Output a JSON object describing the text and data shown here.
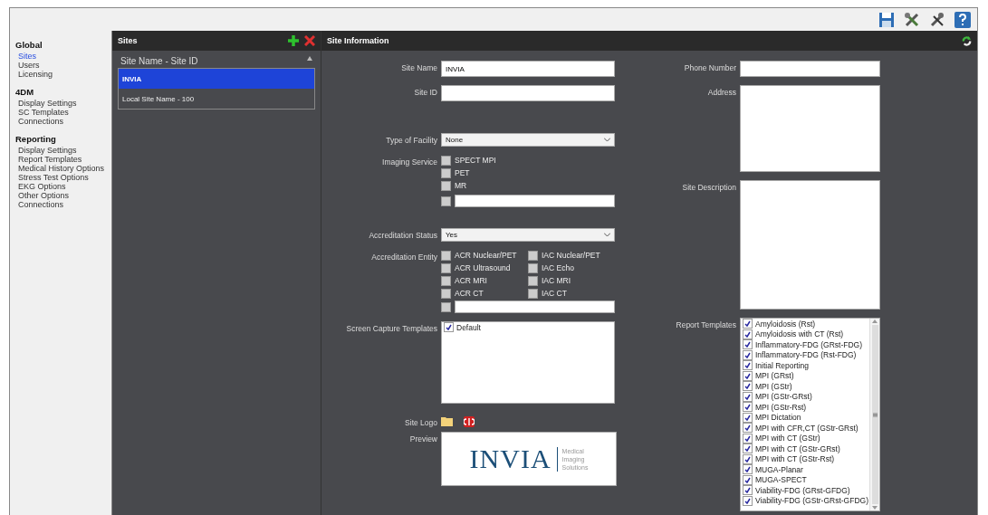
{
  "sidebar": {
    "sections": [
      {
        "title": "Global",
        "items": [
          {
            "label": "Sites",
            "selected": true
          },
          {
            "label": "Users",
            "selected": false
          },
          {
            "label": "Licensing",
            "selected": false
          }
        ]
      },
      {
        "title": "4DM",
        "items": [
          {
            "label": "Display Settings",
            "selected": false
          },
          {
            "label": "SC Templates",
            "selected": false
          },
          {
            "label": "Connections",
            "selected": false
          }
        ]
      },
      {
        "title": "Reporting",
        "items": [
          {
            "label": "Display Settings",
            "selected": false
          },
          {
            "label": "Report Templates",
            "selected": false
          },
          {
            "label": "Medical History Options",
            "selected": false
          },
          {
            "label": "Stress Test Options",
            "selected": false
          },
          {
            "label": "EKG Options",
            "selected": false
          },
          {
            "label": "Other Options",
            "selected": false
          },
          {
            "label": "Connections",
            "selected": false
          }
        ]
      }
    ]
  },
  "sites": {
    "title": "Sites",
    "column": "Site Name - Site ID",
    "rows": [
      {
        "label": "INVIA",
        "selected": true
      },
      {
        "label": "Local Site Name - 100",
        "selected": false
      }
    ]
  },
  "site_information": {
    "title": "Site Information",
    "site_name": {
      "label": "Site Name",
      "value": "INVIA"
    },
    "site_id": {
      "label": "Site ID"
    },
    "type_of_facility": {
      "label": "Type of Facility",
      "value": "None"
    },
    "imaging_service": {
      "label": "Imaging Service",
      "options": [
        {
          "label": "SPECT MPI",
          "checked": false
        },
        {
          "label": "PET",
          "checked": false
        },
        {
          "label": "MR",
          "checked": false
        }
      ],
      "other_checked": false
    },
    "accreditation_status": {
      "label": "Accreditation Status",
      "value": "Yes"
    },
    "accreditation_entity": {
      "label": "Accreditation Entity",
      "options": [
        {
          "label": "ACR Nuclear/PET",
          "checked": false
        },
        {
          "label": "IAC Nuclear/PET",
          "checked": false
        },
        {
          "label": "ACR Ultrasound",
          "checked": false
        },
        {
          "label": "IAC Echo",
          "checked": false
        },
        {
          "label": "ACR MRI",
          "checked": false
        },
        {
          "label": "IAC MRI",
          "checked": false
        },
        {
          "label": "ACR CT",
          "checked": false
        },
        {
          "label": "IAC CT",
          "checked": false
        }
      ],
      "other_checked": false
    },
    "screen_capture_templates": {
      "label": "Screen Capture Templates",
      "items": [
        {
          "label": "Default",
          "checked": true
        }
      ]
    },
    "site_logo": {
      "label": "Site Logo"
    },
    "preview": {
      "label": "Preview",
      "logo_text": "INVIA",
      "logo_tagline": [
        "Medical",
        "Imaging",
        "Solutions"
      ]
    },
    "phone_number": {
      "label": "Phone Number"
    },
    "address": {
      "label": "Address"
    },
    "site_description": {
      "label": "Site Description"
    },
    "report_templates": {
      "label": "Report Templates",
      "items": [
        {
          "label": "Amyloidosis (Rst)",
          "checked": true
        },
        {
          "label": "Amyloidosis with CT (Rst)",
          "checked": true
        },
        {
          "label": "Inflammatory-FDG (GRst-FDG)",
          "checked": true
        },
        {
          "label": "Inflammatory-FDG (Rst-FDG)",
          "checked": true
        },
        {
          "label": "Initial Reporting",
          "checked": true
        },
        {
          "label": "MPI (GRst)",
          "checked": true
        },
        {
          "label": "MPI (GStr)",
          "checked": true
        },
        {
          "label": "MPI (GStr-GRst)",
          "checked": true
        },
        {
          "label": "MPI (GStr-Rst)",
          "checked": true
        },
        {
          "label": "MPI Dictation",
          "checked": true
        },
        {
          "label": "MPI with CFR,CT (GStr-GRst)",
          "checked": true
        },
        {
          "label": "MPI with CT (GStr)",
          "checked": true
        },
        {
          "label": "MPI with CT (GStr-GRst)",
          "checked": true
        },
        {
          "label": "MPI with CT (GStr-Rst)",
          "checked": true
        },
        {
          "label": "MUGA-Planar",
          "checked": true
        },
        {
          "label": "MUGA-SPECT",
          "checked": true
        },
        {
          "label": "Viability-FDG (GRst-GFDG)",
          "checked": true
        },
        {
          "label": "Viability-FDG (GStr-GRst-GFDG)",
          "checked": true
        }
      ]
    }
  }
}
